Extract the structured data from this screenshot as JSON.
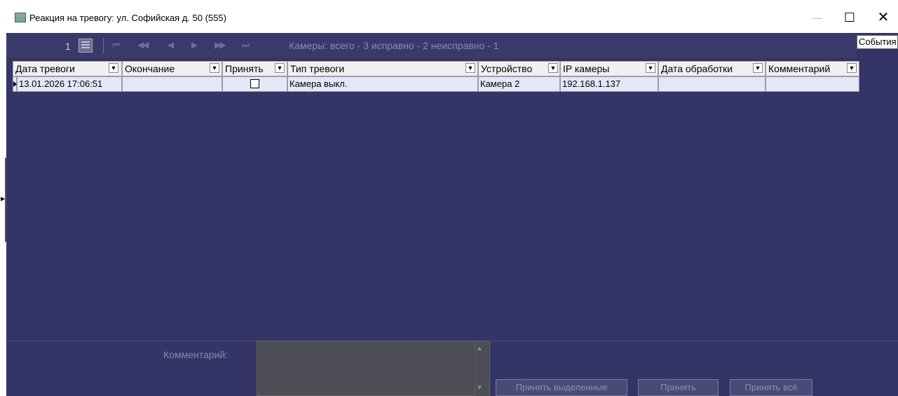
{
  "window": {
    "title": "Реакция на тревогу: ул. Софийская д. 50 (555)",
    "icons": {
      "app": "window-app-icon",
      "minimize": "minimize-icon",
      "maximize": "maximize-icon",
      "close": "close-icon"
    },
    "minimize_glyph": "—",
    "maximize_glyph": "☐",
    "close_glyph": "✕"
  },
  "nav": {
    "page": "1",
    "first": "⏮",
    "prev_page": "◀◀",
    "prev": "◀",
    "next": "▶",
    "next_page": "▶▶",
    "last": "⏭",
    "cameras_status": "Камеры: всего - 3  исправно - 2  неисправно - 1"
  },
  "events_button": "События",
  "table": {
    "columns": [
      "Дата тревоги",
      "Окончание",
      "Принять",
      "Тип тревоги",
      "Устройство",
      "IP камеры",
      "Дата обработки",
      "Комментарий"
    ],
    "dropdown_glyph": "▼",
    "rows": [
      {
        "alarm_date": "13.01.2026 17:06:51",
        "end": "",
        "accept": false,
        "alarm_type": "Камера выкл.",
        "device": "Камера 2",
        "ip": "192.168.1.137",
        "processed_date": "",
        "comment": ""
      }
    ]
  },
  "bottom": {
    "comment_label": "Комментарий:",
    "comment_value": "",
    "accept_selected": "Принять выделенные",
    "accept": "Принять",
    "accept_all": "Принять всё",
    "scroll_up": "▲",
    "scroll_down": "▼"
  },
  "colors": {
    "background": "#343466",
    "row_background": "#e6e6f6",
    "header_background": "#f0f0f0"
  }
}
